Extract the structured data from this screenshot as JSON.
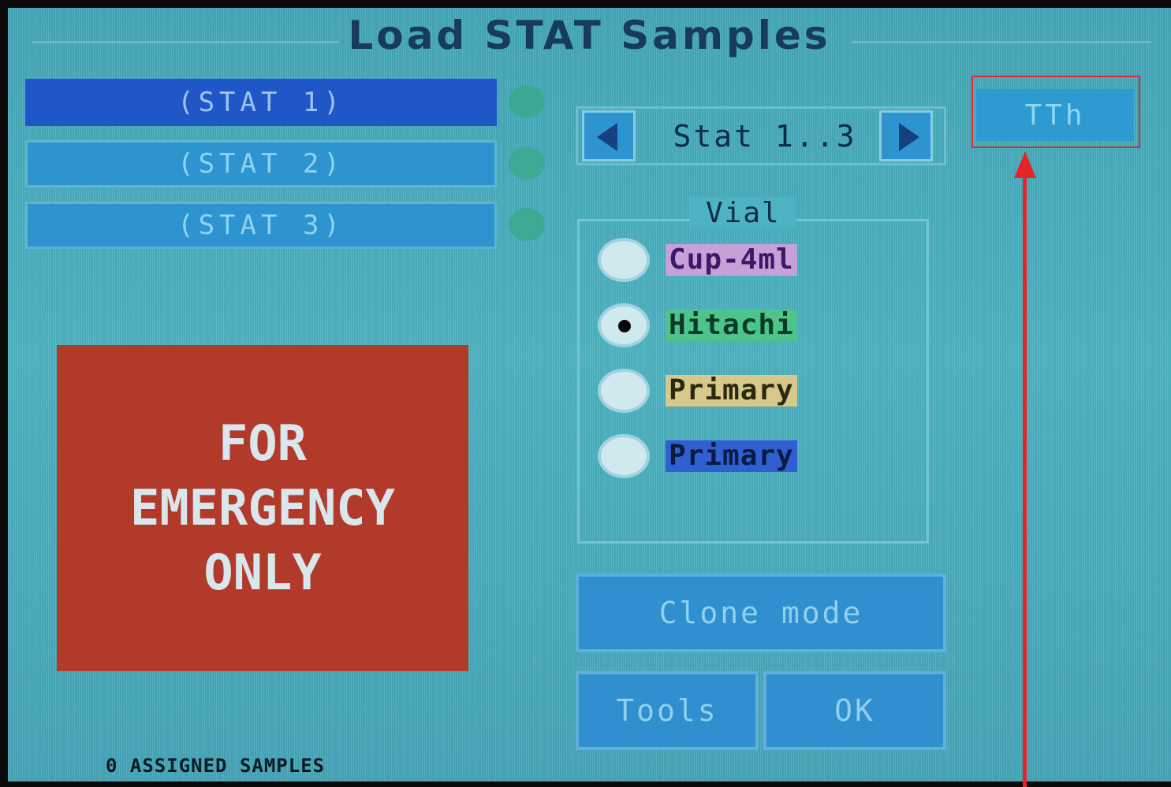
{
  "window": {
    "title": "Load STAT Samples"
  },
  "stat_slots": [
    {
      "label": "(STAT 1)",
      "selected": true
    },
    {
      "label": "(STAT 2)",
      "selected": false
    },
    {
      "label": "(STAT 3)",
      "selected": false
    }
  ],
  "navigator": {
    "range_label": "Stat 1..3"
  },
  "tth_button": {
    "label": "TTh"
  },
  "vial": {
    "legend": "Vial",
    "options": [
      {
        "label": "Cup-4ml",
        "selected": false,
        "color": "#c8a0d8"
      },
      {
        "label": "Hitachi",
        "selected": true,
        "color": "#4cc48a"
      },
      {
        "label": "Primary",
        "selected": false,
        "color": "#d8c88a"
      },
      {
        "label": "Primary",
        "selected": false,
        "color": "#2f5fd0"
      }
    ]
  },
  "emergency_panel": {
    "line1": "FOR",
    "line2": "EMERGENCY",
    "line3": "ONLY"
  },
  "buttons": {
    "clone_mode": "Clone mode",
    "tools": "Tools",
    "ok": "OK"
  },
  "status": {
    "text": "0 ASSIGNED SAMPLES"
  },
  "colors": {
    "highlight": "#e2262c",
    "screen_bg": "#4db2c2",
    "emergency_bg": "#b23a2b"
  }
}
